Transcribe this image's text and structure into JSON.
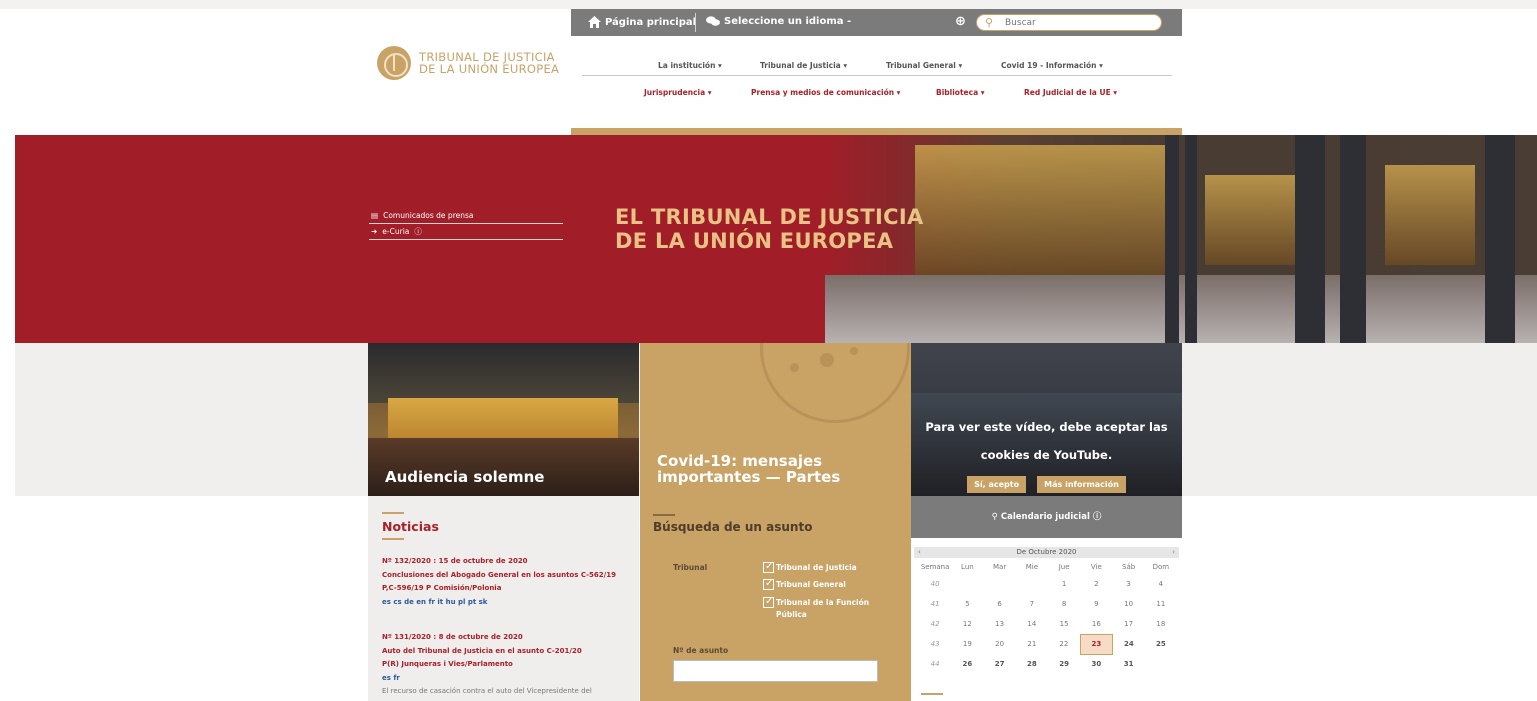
{
  "logo": {
    "line1": "TRIBUNAL DE JUSTICIA",
    "line2": "DE LA UNIÓN EUROPEA"
  },
  "util": {
    "home": "Página principal",
    "language": "Seleccione un idioma -",
    "search_placeholder": "Buscar"
  },
  "nav_primary": [
    "La institución ▾",
    "Tribunal de Justicia ▾",
    "Tribunal General ▾",
    "Covid 19 - Información ▾"
  ],
  "nav_secondary": [
    "Jurisprudencia ▾",
    "Prensa y medios de comunicación ▾",
    "Biblioteca ▾",
    "Red Judicial de la UE ▾"
  ],
  "hero": {
    "links": [
      "Comunicados de prensa",
      "e-Curia"
    ],
    "title_line1": "EL TRIBUNAL DE JUSTICIA",
    "title_line2": "DE LA UNIÓN EUROPEA"
  },
  "tiles": {
    "t1": "Audiencia solemne",
    "t2_line1": "Covid-19: mensajes",
    "t2_line2": "importantes — Partes",
    "yt_line1": "Para ver este vídeo, debe aceptar las",
    "yt_line2": "cookies de YouTube.",
    "yt_accept": "Sí, acepto",
    "yt_more": "Más información"
  },
  "news": {
    "title": "Noticias",
    "items": [
      {
        "head": "Nº 132/2020 : 15 de octubre de 2020",
        "line1": "Conclusiones del Abogado General en los asuntos C-562/19",
        "line2": "P,C-596/19 P Comisión/Polonia",
        "langs": "es cs de en fr it hu pl pt sk"
      },
      {
        "head": "Nº 131/2020 : 8 de octubre de 2020",
        "line1": "Auto del Tribunal de Justicia en el asunto C-201/20",
        "line2": "P(R) Junqueras i Vies/Parlamento",
        "langs": "es fr",
        "desc": "El recurso de casación contra el auto del Vicepresidente del"
      }
    ]
  },
  "search": {
    "title": "Búsqueda de un asunto",
    "court_label": "Tribunal",
    "options": [
      "Tribunal de Justicia",
      "Tribunal General",
      "Tribunal de la Función",
      "Pública"
    ],
    "case_label": "Nº de asunto"
  },
  "calendar": {
    "title": "Calendario judicial",
    "month": "De Octubre 2020",
    "headers": [
      "Semana",
      "Lun",
      "Mar",
      "Mie",
      "Jue",
      "Vie",
      "Sáb",
      "Dom"
    ],
    "rows": [
      [
        "40",
        "",
        "",
        "",
        "1",
        "2",
        "3",
        "4"
      ],
      [
        "41",
        "5",
        "6",
        "7",
        "8",
        "9",
        "10",
        "11"
      ],
      [
        "42",
        "12",
        "13",
        "14",
        "15",
        "16",
        "17",
        "18"
      ],
      [
        "43",
        "19",
        "20",
        "21",
        "22",
        "23",
        "24",
        "25"
      ],
      [
        "44",
        "26",
        "27",
        "28",
        "29",
        "30",
        "31",
        ""
      ]
    ]
  },
  "colors": {
    "brand_red": "#a11e28",
    "gold": "#c9a266",
    "grey_bar": "#7b7b7b"
  }
}
